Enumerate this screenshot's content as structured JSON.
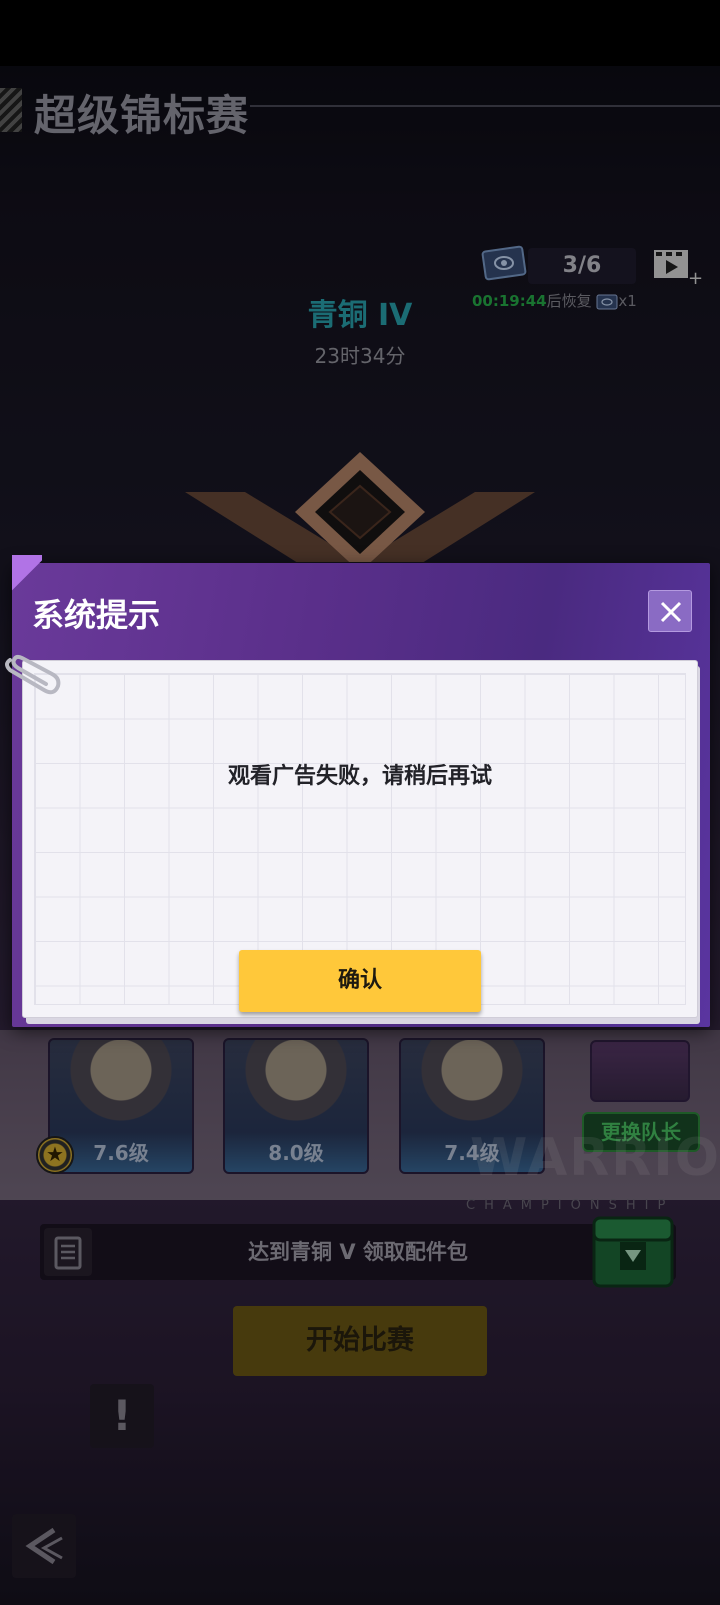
{
  "header": {
    "title": "超级锦标赛"
  },
  "tickets": {
    "count": "3/6",
    "recover_time": "00:19:44",
    "recover_suffix": "后恢复",
    "recover_amount": "x1"
  },
  "rank": {
    "name": "青铜 IV",
    "time_left": "23时34分"
  },
  "team": {
    "levels": [
      "7.6级",
      "8.0级",
      "7.4级"
    ],
    "change_captain_label": "更换队长"
  },
  "branding": {
    "warrior": "WARRIOR",
    "championship": "CHAMPIONSHIP"
  },
  "reward": {
    "text": "达到青铜 V 领取配件包"
  },
  "start_button_label": "开始比赛",
  "alert_label": "!",
  "dialog": {
    "title": "系统提示",
    "message": "观看广告失败，请稍后再试",
    "confirm_label": "确认"
  },
  "colors": {
    "rank": "#2aa6b3",
    "recover_time": "#27b14a",
    "confirm": "#ffc83a",
    "dialog": "#5a2f8a"
  }
}
